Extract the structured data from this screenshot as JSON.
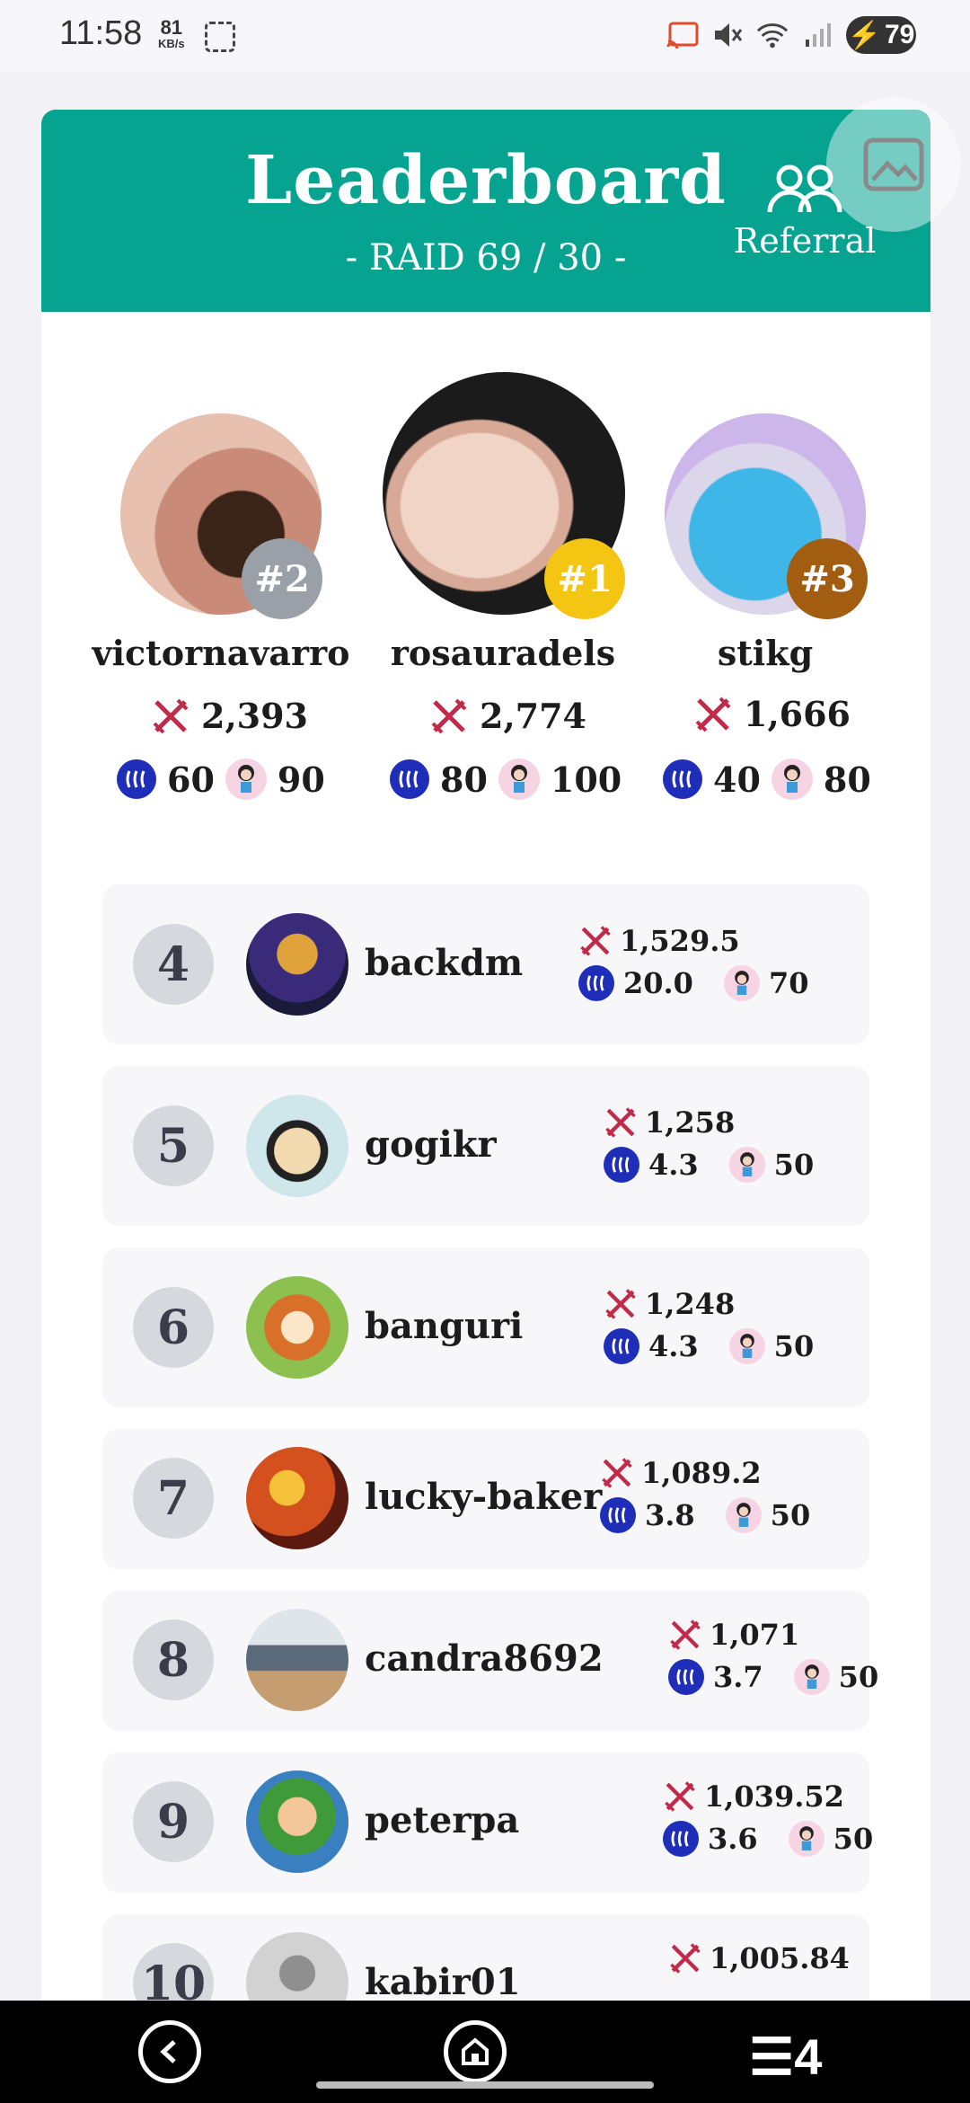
{
  "status_bar": {
    "time": "11:58",
    "speed_value": "81",
    "speed_unit": "KB/s",
    "battery": "79"
  },
  "header": {
    "title": "Leaderboard",
    "subtitle": "- RAID 69 / 30 -",
    "referral_label": "Referral",
    "bg_color": "#05a390"
  },
  "podium": [
    {
      "rank": "#2",
      "name": "victornavarro",
      "score": "2,393",
      "coins": "60",
      "tickets": "90",
      "badge_color": "#9aa0a8"
    },
    {
      "rank": "#1",
      "name": "rosauradels",
      "score": "2,774",
      "coins": "80",
      "tickets": "100",
      "badge_color": "#f4c512"
    },
    {
      "rank": "#3",
      "name": "stikg",
      "score": "1,666",
      "coins": "40",
      "tickets": "80",
      "badge_color": "#a25d10"
    }
  ],
  "rows": [
    {
      "rank": "4",
      "name": "backdm",
      "score": "1,529.5",
      "coins": "20.0",
      "tickets": "70"
    },
    {
      "rank": "5",
      "name": "gogikr",
      "score": "1,258",
      "coins": "4.3",
      "tickets": "50"
    },
    {
      "rank": "6",
      "name": "banguri",
      "score": "1,248",
      "coins": "4.3",
      "tickets": "50"
    },
    {
      "rank": "7",
      "name": "lucky-baker",
      "score": "1,089.2",
      "coins": "3.8",
      "tickets": "50"
    },
    {
      "rank": "8",
      "name": "candra8692",
      "score": "1,071",
      "coins": "3.7",
      "tickets": "50"
    },
    {
      "rank": "9",
      "name": "peterpa",
      "score": "1,039.52",
      "coins": "3.6",
      "tickets": "50"
    },
    {
      "rank": "10",
      "name": "kabir01",
      "score": "1,005.84",
      "coins": "",
      "tickets": ""
    }
  ],
  "icons": {
    "score": "crossed-swords-icon",
    "coin": "steem-coin-icon",
    "ticket": "character-ticket-icon",
    "referral": "people-icon"
  }
}
